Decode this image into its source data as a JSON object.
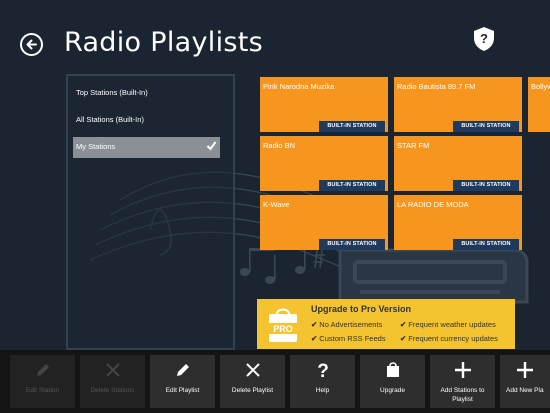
{
  "header": {
    "title": "Radio Playlists"
  },
  "playlists": [
    {
      "label": "Top Stations (Built-In)",
      "selected": false
    },
    {
      "label": "All Stations (Built-In)",
      "selected": false
    },
    {
      "label": "My Stations",
      "selected": true
    }
  ],
  "stations": [
    {
      "name": "Pink Narodna Muzika",
      "tag": "BUILT-IN STATION"
    },
    {
      "name": "Radio Bautista 89.7 FM",
      "tag": "BUILT-IN STATION"
    },
    {
      "name": "Bollyw",
      "tag": ""
    },
    {
      "name": "Radio BN",
      "tag": "BUILT-IN STATION"
    },
    {
      "name": "STAR FM",
      "tag": "BUILT-IN STATION"
    },
    {
      "name": "K-Wave",
      "tag": "BUILT-IN STATION"
    },
    {
      "name": "LA RADIO DE MODA",
      "tag": "BUILT-IN STATION"
    }
  ],
  "upgrade": {
    "title": "Upgrade to Pro Version",
    "icon_text": "PRO",
    "features": [
      "No Advertisements",
      "Frequent weather updates",
      "Custom RSS Feeds",
      "Frequent currency updates"
    ]
  },
  "app_bar": {
    "buttons": [
      {
        "label": "Edit Station",
        "icon": "pencil-icon",
        "enabled": false
      },
      {
        "label": "Delete Stations",
        "icon": "x-icon",
        "enabled": false
      },
      {
        "label": "Edit Playlist",
        "icon": "pencil-icon",
        "enabled": true
      },
      {
        "label": "Delete Playlist",
        "icon": "x-icon",
        "enabled": true
      },
      {
        "label": "Help",
        "icon": "question-icon",
        "enabled": true
      },
      {
        "label": "Upgrade",
        "icon": "shopping-bag-icon",
        "enabled": true
      },
      {
        "label": "Add Stations to Playlist",
        "icon": "plus-icon",
        "enabled": true
      },
      {
        "label": "Add New Pla",
        "icon": "plus-icon",
        "enabled": true
      }
    ]
  },
  "colors": {
    "background": "#1b2531",
    "tile": "#f7961e",
    "tile_tag": "#1e3a5c",
    "banner": "#f4c430",
    "app_bar": "#141414"
  }
}
